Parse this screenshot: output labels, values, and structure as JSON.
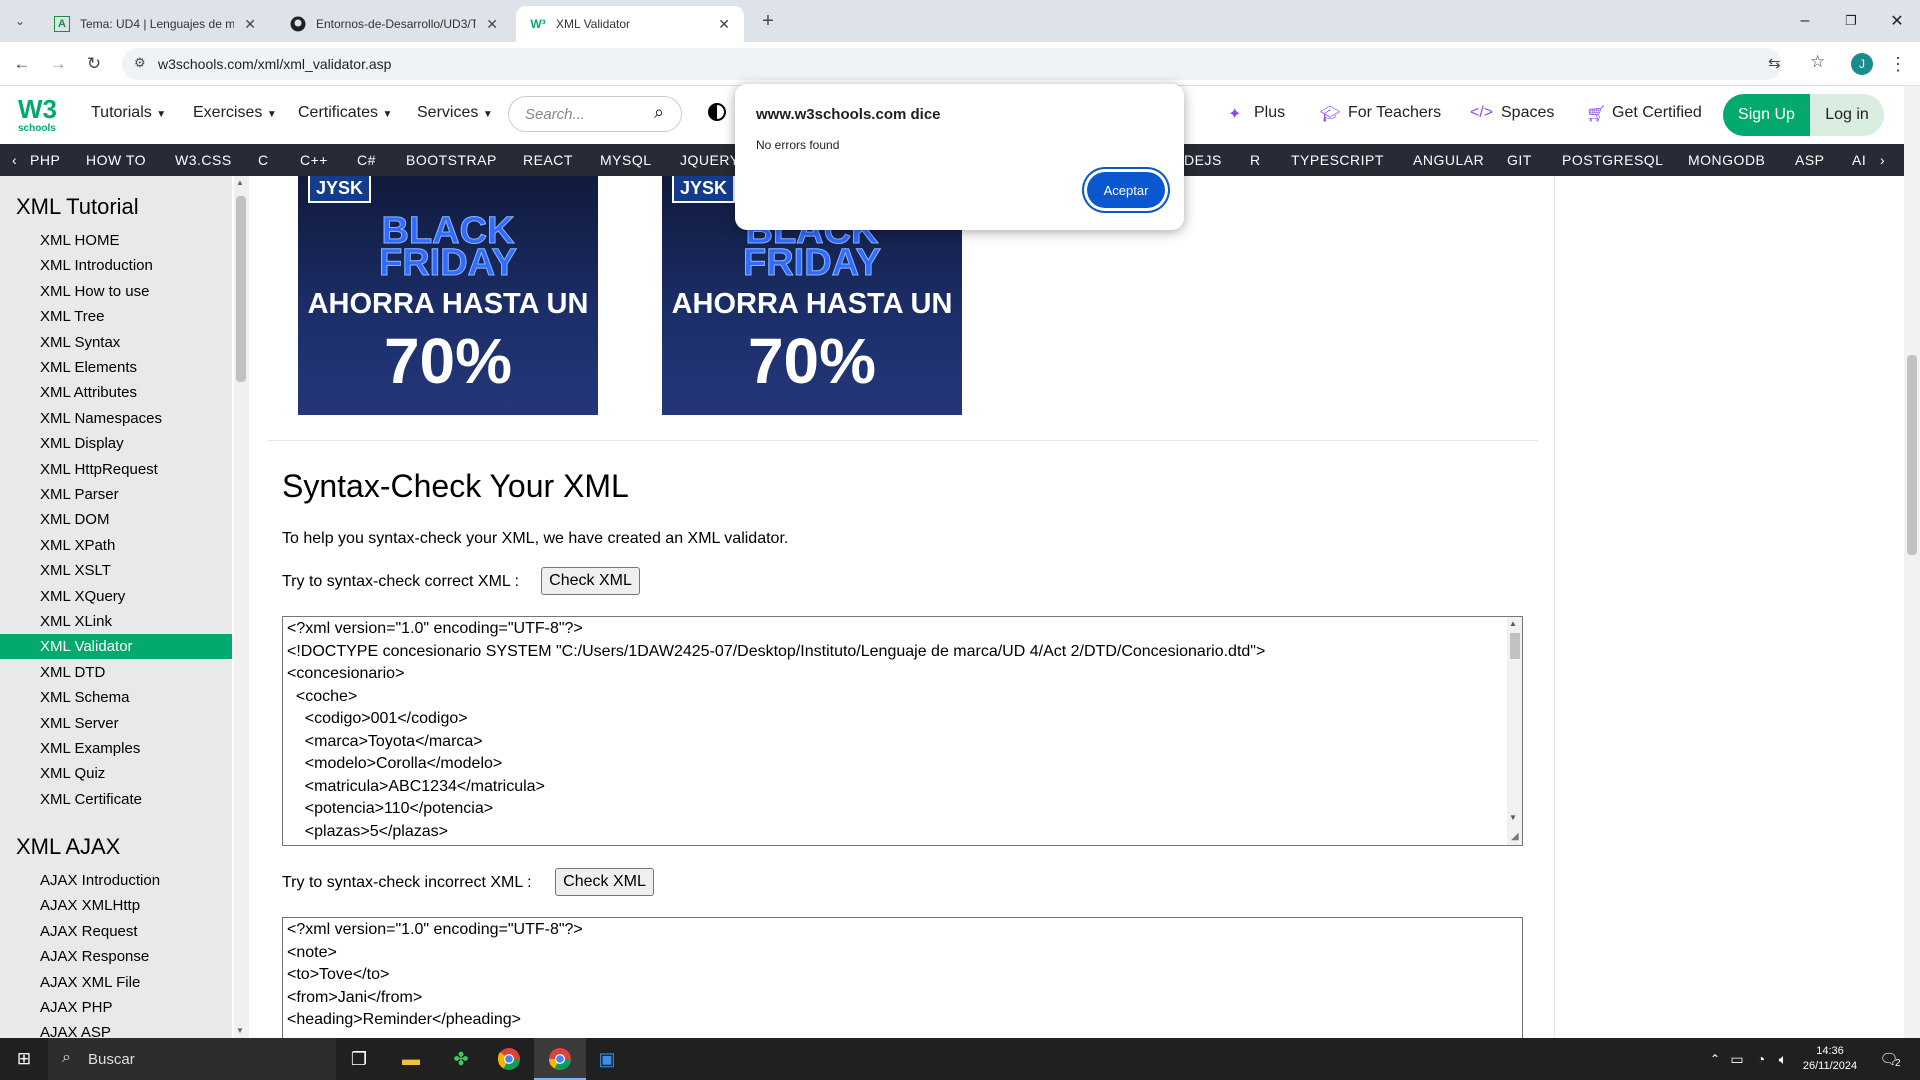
{
  "browser": {
    "tabs": [
      {
        "title": "Tema: UD4 | Lenguajes de marc",
        "icon": "A"
      },
      {
        "title": "Entornos-de-Desarrollo/UD3/Ta",
        "icon": "github-icon"
      },
      {
        "title": "XML Validator",
        "icon": "w3"
      }
    ],
    "new_tab": "+",
    "url": "w3schools.com/xml/xml_validator.asp",
    "profile_initial": "J"
  },
  "topnav": {
    "logo_top": "W3",
    "logo_bottom": "schools",
    "items": [
      "Tutorials",
      "Exercises",
      "Certificates",
      "Services"
    ],
    "search_placeholder": "Search...",
    "right_items": [
      "Plus",
      "For Teachers",
      "Spaces",
      "Get Certified"
    ],
    "signup": "Sign Up",
    "login": "Log in"
  },
  "subnav": {
    "left_items": [
      "PHP",
      "HOW TO",
      "W3.CSS",
      "C",
      "C++",
      "C#",
      "BOOTSTRAP",
      "REACT",
      "MYSQL",
      "JQUERY"
    ],
    "right_items": [
      "DEJS",
      "R",
      "TYPESCRIPT",
      "ANGULAR",
      "GIT",
      "POSTGRESQL",
      "MONGODB",
      "ASP",
      "AI"
    ]
  },
  "sidebar": {
    "heading1": "XML Tutorial",
    "items1": [
      "XML HOME",
      "XML Introduction",
      "XML How to use",
      "XML Tree",
      "XML Syntax",
      "XML Elements",
      "XML Attributes",
      "XML Namespaces",
      "XML Display",
      "XML HttpRequest",
      "XML Parser",
      "XML DOM",
      "XML XPath",
      "XML XSLT",
      "XML XQuery",
      "XML XLink",
      "XML Validator",
      "XML DTD",
      "XML Schema",
      "XML Server",
      "XML Examples",
      "XML Quiz",
      "XML Certificate"
    ],
    "active": "XML Validator",
    "heading2": "XML AJAX",
    "items2": [
      "AJAX Introduction",
      "AJAX XMLHttp",
      "AJAX Request",
      "AJAX Response",
      "AJAX XML File",
      "AJAX PHP",
      "AJAX ASP"
    ]
  },
  "ads": {
    "brand": "JYSK",
    "line1": "BLACK",
    "line2": "FRIDAY",
    "line3": "AHORRA HASTA UN",
    "line4": "70%"
  },
  "main": {
    "title": "Syntax-Check Your XML",
    "intro": "To help you syntax-check your XML, we have created an XML validator.",
    "correct_label": "Try to syntax-check correct XML :",
    "incorrect_label": "Try to syntax-check incorrect XML :",
    "check_button": "Check XML",
    "correct_xml": [
      "<?xml version=\"1.0\" encoding=\"UTF-8\"?>",
      "<!DOCTYPE concesionario SYSTEM \"C:/Users/1DAW2425-07/Desktop/Instituto/Lenguaje de marca/UD 4/Act 2/DTD/Concesionario.dtd\">",
      "<concesionario>",
      "  <coche>",
      "    <codigo>001</codigo>",
      "    <marca>Toyota</marca>",
      "    <modelo>Corolla</modelo>",
      "    <matricula>ABC1234</matricula>",
      "    <potencia>110</potencia>",
      "    <plazas>5</plazas>"
    ],
    "incorrect_xml": [
      "<?xml version=\"1.0\" encoding=\"UTF-8\"?>",
      "<note>",
      "<to>Tove</to>",
      "<from>Jani</from>",
      "<heading>Reminder</pheading>"
    ]
  },
  "dialog": {
    "title": "www.w3schools.com dice",
    "message": "No errors found",
    "ok": "Aceptar"
  },
  "taskbar": {
    "search": "Buscar",
    "time": "14:36",
    "date": "26/11/2024",
    "notifications": "2"
  }
}
